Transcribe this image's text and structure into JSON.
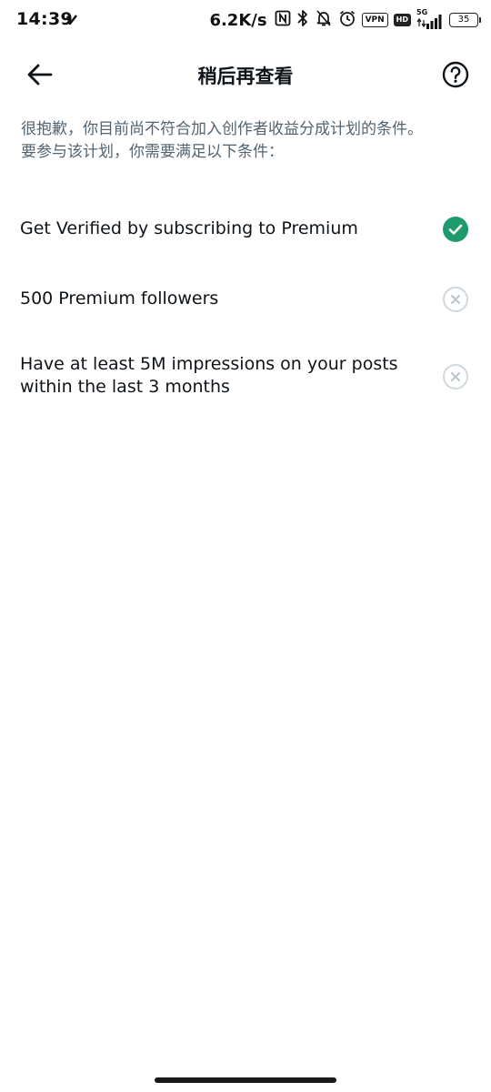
{
  "status_bar": {
    "time": "14:39",
    "speed": "6.2K/s",
    "vpn_label": "VPN",
    "hd_label": "HD",
    "network_label": "5G",
    "battery": "35"
  },
  "header": {
    "title": "稍后再查看"
  },
  "intro": {
    "line1": "很抱歉，你目前尚不符合加入创作者收益分成计划的条件。",
    "line2": "要参与该计划，你需要满足以下条件："
  },
  "requirements": [
    {
      "label": "Get Verified by subscribing to Premium",
      "met": true,
      "status_icon": "check-circle-icon",
      "color": "#1d9b6c"
    },
    {
      "label": "500 Premium followers",
      "met": false,
      "status_icon": "x-circle-icon",
      "color": "#cfd9de"
    },
    {
      "label": "Have at least 5M impressions on your posts within the last 3 months",
      "met": false,
      "status_icon": "x-circle-icon",
      "color": "#cfd9de"
    }
  ],
  "colors": {
    "text_primary": "#0f1419",
    "text_secondary": "#536471",
    "success": "#1d9b6c",
    "inactive": "#cfd9de"
  }
}
